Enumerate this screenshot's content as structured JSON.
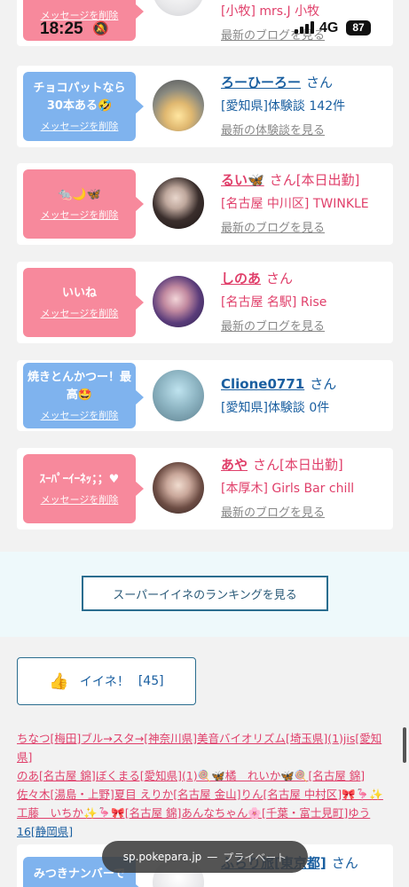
{
  "status": {
    "time": "18:25",
    "network": "4G",
    "battery": "87"
  },
  "top_partial": {
    "location": "[小牧] mrs.J 小牧",
    "more_link": "最新のブログを見る",
    "bubble_delete": "メッセージを削除"
  },
  "cards": [
    {
      "bubble_text": "チョコパットなら30本ある🤣",
      "delete": "メッセージを削除",
      "name": "ろーひーろー",
      "suffix": "さん",
      "location": "[愛知県]体験談 142件",
      "more": "最新の体験談を見る"
    },
    {
      "bubble_text": "🐀🌙🦋",
      "delete": "メッセージを削除",
      "name": "るい🦋",
      "suffix": "さん[本日出勤]",
      "location": "[名古屋 中川区] TWINKLE",
      "more": "最新のブログを見る"
    },
    {
      "bubble_text": "いいね",
      "delete": "メッセージを削除",
      "name": "しのあ",
      "suffix": "さん",
      "location": "[名古屋 名駅] Rise",
      "more": "最新のブログを見る"
    },
    {
      "bubble_text": "焼きとんかつー！最高🤩",
      "delete": "メッセージを削除",
      "name": "Clione0771",
      "suffix": "さん",
      "location": "[愛知県]体験談 0件",
      "more": ""
    },
    {
      "bubble_text": "ｽｰﾊﾟｰｲｰﾈｯ；；♥",
      "delete": "メッセージを削除",
      "name": "あや",
      "suffix": "さん[本日出勤]",
      "location": "[本厚木] Girls Bar chill",
      "more": "最新のブログを見る"
    }
  ],
  "ranking_button": "スーパーイイネのランキングを見る",
  "like_button": {
    "label": "イイネ！",
    "count": "[45]"
  },
  "likers_lines": [
    "ちなつ[梅田]ブル→スタ→[神奈川県]美音バイオリズム[埼玉県](1)jis[愛知県]",
    "のあ[名古屋 錦]ぼくまる[愛知県](1)🍭🦋橘　れいか🦋🍭[名古屋 錦]",
    "佐々木[湯島・上野]夏目 えりか[名古屋 金山]りん[名古屋 中村区]🎀🦩✨",
    "工藤　いちか✨🦩🎀[名古屋 錦]あんなちゃん🌸[千葉・富士見町]ゆう",
    "16[静岡県]"
  ],
  "bottom_partial": {
    "bubble_text": "みつきナンバーで",
    "name": "ふらり旅[東京都]",
    "suffix": "さん"
  },
  "url_pill": {
    "domain": "sp.pokepara.jp",
    "separator": "—",
    "mode": "プライベート"
  }
}
